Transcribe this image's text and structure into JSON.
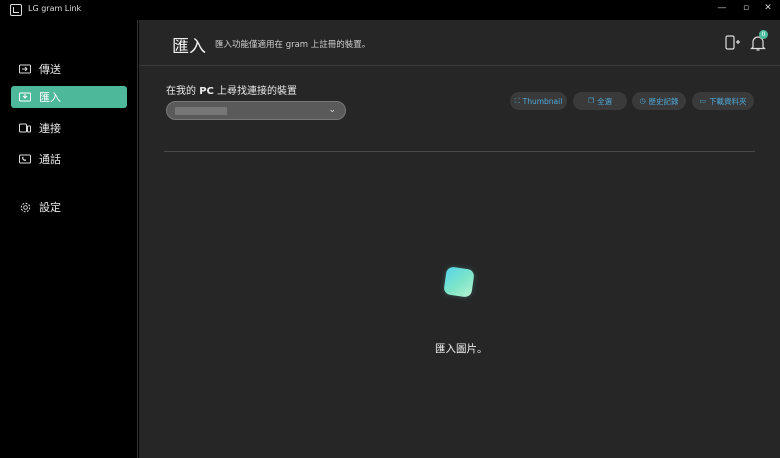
{
  "window": {
    "title": "LG gram Link",
    "controls": {
      "minimize": "—",
      "restore": "▫",
      "close": "✕"
    }
  },
  "sidebar": {
    "items": [
      {
        "label": "傳送",
        "icon": "send-icon"
      },
      {
        "label": "匯入",
        "icon": "import-icon",
        "active": true
      },
      {
        "label": "連接",
        "icon": "connect-icon"
      },
      {
        "label": "通話",
        "icon": "call-icon"
      },
      {
        "label": "設定",
        "icon": "gear-icon"
      }
    ]
  },
  "header": {
    "title": "匯入",
    "description": "匯入功能僅適用在 gram 上註冊的裝置。",
    "notification_count": "0"
  },
  "device_section": {
    "label_prefix": "在我的 ",
    "label_bold": "PC",
    "label_suffix": " 上尋找連接的裝置"
  },
  "toolbar": {
    "thumbnail": "Thumbnail",
    "select_all": "全選",
    "history": "歷史記錄",
    "download_folder": "下載資料夾"
  },
  "empty_state": {
    "text": "匯入圖片。"
  },
  "colors": {
    "accent": "#4db89a",
    "link": "#4fa8d8",
    "background": "#262626",
    "sidebar": "#000000"
  }
}
